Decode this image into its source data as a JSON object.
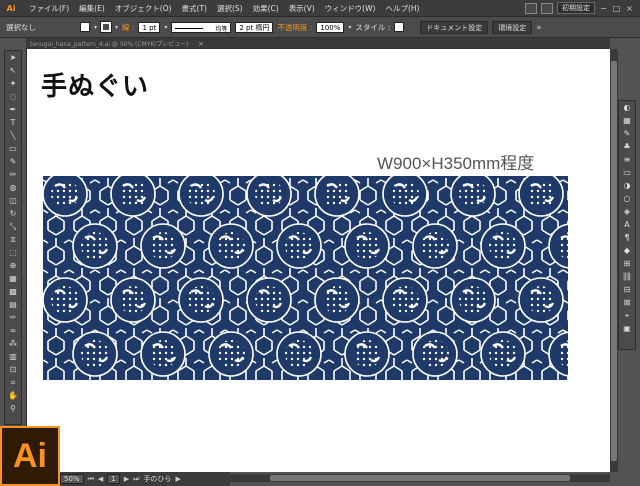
{
  "app": {
    "logo_text": "Ai",
    "menus": [
      "ファイル(F)",
      "編集(E)",
      "オブジェクト(O)",
      "書式(T)",
      "選択(S)",
      "効果(C)",
      "表示(V)",
      "ウィンドウ(W)",
      "ヘルプ(H)"
    ],
    "workspace_preset": "初期設定",
    "win_controls": [
      "−",
      "□",
      "×"
    ]
  },
  "control_bar": {
    "selection_status": "選択なし",
    "stroke_label": "線 :",
    "stroke_weight": "1 pt",
    "line_style": "均等",
    "brush": "2 pt 楕円",
    "opacity_label": "不透明度 :",
    "opacity_value": "100%",
    "style_label": "スタイル :",
    "doc_settings_button": "ドキュメント設定",
    "prefs_button": "環境設定"
  },
  "document": {
    "tab_title": "tenugui_hana_pattern_4.ai @ 50% (CMYK/プレビュー)",
    "heading": "手ぬぐい",
    "dimensions": "W900×H350mm程度"
  },
  "status_bar": {
    "zoom": "50%",
    "artboard": "1",
    "tool_name": "手のひら"
  },
  "colors": {
    "accent": "#f7931e",
    "pattern_bg": "#1f3a68",
    "pattern_line": "#ffffff"
  }
}
